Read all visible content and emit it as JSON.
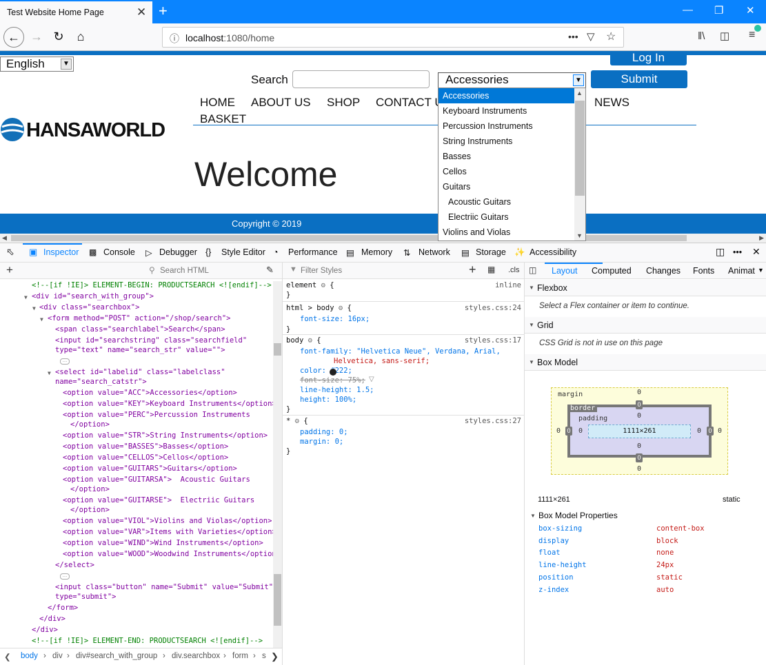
{
  "browser": {
    "tab_title": "Test Website Home Page",
    "tab_close": "✕",
    "new_tab": "+",
    "url_host": "localhost",
    "url_rest": ":1080/home",
    "page_actions": "•••"
  },
  "site": {
    "language": "English",
    "login_label": "Log In",
    "search_label": "Search",
    "search_value": "",
    "category_selected": "Accessories",
    "submit_label": "Submit",
    "nav": [
      "HOME",
      "ABOUT US",
      "SHOP",
      "CONTACT U",
      "NEWS",
      "BASKET"
    ],
    "logo_text": "HANSAWORLD",
    "welcome": "Welcome",
    "copyright": "Copyright © 2019",
    "options": [
      "Accessories",
      "Keyboard Instruments",
      "Percussion Instruments",
      "String Instruments",
      "Basses",
      "Cellos",
      "Guitars",
      "Acoustic Guitars",
      "Electriic Guitars",
      "Violins and Violas"
    ]
  },
  "devtools": {
    "tabs": [
      "Inspector",
      "Console",
      "Debugger",
      "Style Editor",
      "Performance",
      "Memory",
      "Network",
      "Storage",
      "Accessibility"
    ],
    "search_html_placeholder": "Search HTML",
    "filter_styles_placeholder": "Filter Styles",
    "cls_label": ".cls",
    "right_tabs": [
      "Layout",
      "Computed",
      "Changes",
      "Fonts",
      "Animat"
    ],
    "breadcrumbs": [
      "body",
      "div",
      "div#search_with_group",
      "div.searchbox",
      "form",
      "s"
    ],
    "html_lines": [
      "<!--[if !IE]> ELEMENT-BEGIN: PRODUCTSEARCH <![endif]-->",
      "<div id=\"search_with_group\">",
      "<div class=\"searchbox\">",
      "<form method=\"POST\" action=\"/shop/search\">",
      "<span class=\"searchlabel\">Search</span>",
      "<input id=\"searchstring\" class=\"searchfield\"",
      "type=\"text\" name=\"search_str\" value=\"\">",
      "<select id=\"labelid\" class=\"labelclass\"",
      "name=\"search_catstr\">",
      "<option value=\"ACC\">Accessories</option>",
      "<option value=\"KEY\">Keyboard Instruments</option>",
      "<option value=\"PERC\">Percussion Instruments",
      "</option>",
      "<option value=\"STR\">String Instruments</option>",
      "<option value=\"BASSES\">Basses</option>",
      "<option value=\"CELLOS\">Cellos</option>",
      "<option value=\"GUITARS\">Guitars</option>",
      "<option value=\"GUITARSA\">  Acoustic Guitars",
      "</option>",
      "<option value=\"GUITARSE\">  Electriic Guitars",
      "</option>",
      "<option value=\"VIOL\">Violins and Violas</option>",
      "<option value=\"VAR\">Items with Varieties</option>",
      "<option value=\"WIND\">Wind Instruments</option>",
      "<option value=\"WOOD\">Woodwind Instruments</option>",
      "</select>",
      "<input class=\"button\" name=\"Submit\" value=\"Submit\"",
      "type=\"submit\">",
      "</form>",
      "</div>",
      "</div>",
      "<!--[if !IE]> ELEMENT-END: PRODUCTSEARCH <![endif]-->"
    ],
    "rules": {
      "element_selector": "element",
      "element_source": "inline",
      "r1_selector": "html > body",
      "r1_source": "styles.css:24",
      "r1_decl": "font-size: 16px;",
      "r2_selector": "body",
      "r2_source": "styles.css:17",
      "r2_font_family": "font-family: \"Helvetica Neue\", Verdana, Arial,",
      "r2_font_family_2": "Helvetica, sans-serif;",
      "r2_color": "color: #222;",
      "r2_font_size": "font-size: 75%;",
      "r2_line_height": "line-height: 1.5;",
      "r2_height": "height: 100%;",
      "r3_selector": "*",
      "r3_source": "styles.css:27",
      "r3_padding": "padding: 0;",
      "r3_margin": "margin: 0;",
      "open_brace": "{",
      "close_brace": "}"
    },
    "layout": {
      "flexbox_title": "Flexbox",
      "flexbox_note": "Select a Flex container or item to continue.",
      "grid_title": "Grid",
      "grid_note": "CSS Grid is not in use on this page",
      "boxmodel_title": "Box Model",
      "margin_label": "margin",
      "border_label": "border",
      "padding_label": "padding",
      "content_size": "1111×261",
      "zero": "0",
      "size_readout": "1111×261",
      "position_readout": "static",
      "props_title": "Box Model Properties",
      "props": [
        {
          "name": "box-sizing",
          "value": "content-box"
        },
        {
          "name": "display",
          "value": "block"
        },
        {
          "name": "float",
          "value": "none"
        },
        {
          "name": "line-height",
          "value": "24px"
        },
        {
          "name": "position",
          "value": "static"
        },
        {
          "name": "z-index",
          "value": "auto"
        }
      ]
    }
  }
}
